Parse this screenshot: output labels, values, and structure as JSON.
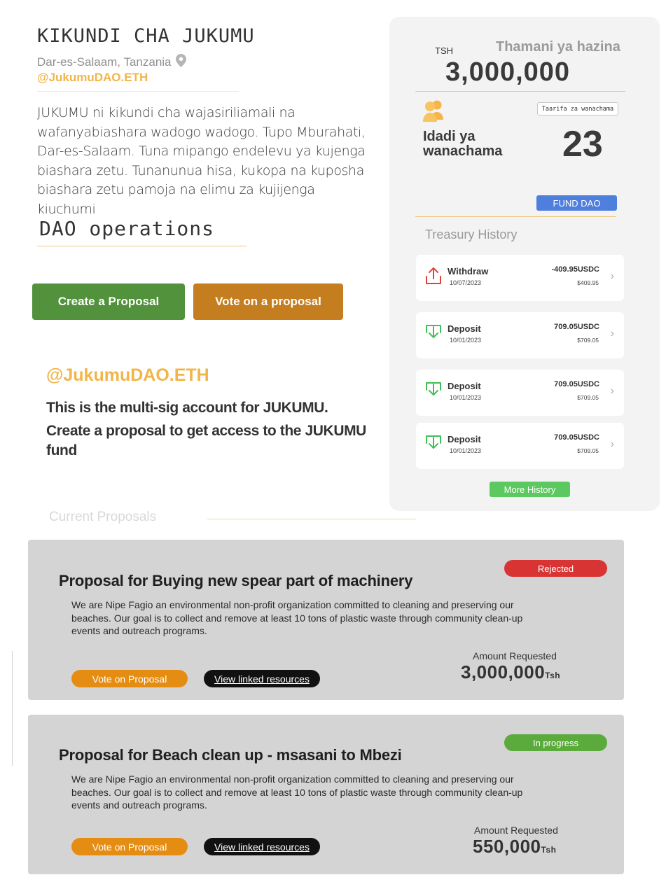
{
  "header": {
    "group_name": "KIKUNDI CHA JUKUMU",
    "location": "Dar-es-Salaam, Tanzania",
    "handle": "@JukumuDAO.ETH",
    "description": "JUKUMU ni kikundi cha wajasiriliamali na wafanyabiashara wadogo wadogo. Tupo Mburahati, Dar-es-Salaam. Tuna mipango endelevu ya kujenga biashara zetu. Tunanunua hisa, kukopa na kuposha biashara zetu pamoja na elimu za kujijenga kiuchumi"
  },
  "operations": {
    "title": "DAO operations",
    "create_label": "Create a Proposal",
    "vote_label": "Vote on a proposal"
  },
  "multisig": {
    "handle": "@JukumuDAO.ETH",
    "line1": "This is the multi-sig account for JUKUMU.",
    "line2": "Create a proposal to get access to the JUKUMU fund"
  },
  "current_proposals_label": "Current Proposals",
  "treasury": {
    "currency": "TSH",
    "label": "Thamani ya hazina",
    "value": "3,000,000",
    "members_button": "Taarifa za wanachama",
    "members_label": "Idadi ya wanachama",
    "members_count": "23",
    "fund_button": "FUND DAO",
    "history_title": "Treasury History",
    "transactions": [
      {
        "type": "Withdraw",
        "date": "10/07/2023",
        "amount": "-409.95USDC",
        "fiat": "$409.95",
        "direction": "out"
      },
      {
        "type": "Deposit",
        "date": "10/01/2023",
        "amount": "709.05USDC",
        "fiat": "$709.05",
        "direction": "in"
      },
      {
        "type": "Deposit",
        "date": "10/01/2023",
        "amount": "709.05USDC",
        "fiat": "$709.05",
        "direction": "in"
      },
      {
        "type": "Deposit",
        "date": "10/01/2023",
        "amount": "709.05USDC",
        "fiat": "$709.05",
        "direction": "in"
      }
    ],
    "more_button": "More History"
  },
  "proposals": [
    {
      "status": "Rejected",
      "status_color": "#d93434",
      "title": "Proposal for Buying new spear part of machinery",
      "description": "We are Nipe Fagio an environmental non-profit organization committed to cleaning and preserving our beaches. Our goal is to collect and remove at least 10 tons of plastic waste through community clean-up events and outreach programs.",
      "vote_label": "Vote on Proposal",
      "link_label": "View linked resources",
      "amount_label": "Amount Requested",
      "amount": "3,000,000",
      "unit": "Tsh"
    },
    {
      "status": "In progress",
      "status_color": "#5aaa3c",
      "title": "Proposal for Beach clean up - msasani to Mbezi",
      "description": "We are Nipe Fagio an environmental non-profit organization committed to cleaning and preserving our beaches. Our goal is to collect and remove at least 10 tons of plastic waste through community clean-up events and outreach programs.",
      "vote_label": "Vote on Proposal",
      "link_label": "View linked resources",
      "amount_label": "Amount Requested",
      "amount": "550,000",
      "unit": "Tsh"
    }
  ],
  "colors": {
    "accent_orange": "#f2b54a",
    "create_green": "#52923d",
    "vote_brown": "#c47d1f",
    "fund_blue": "#4f7fdc",
    "more_green": "#5cc860",
    "withdraw_red": "#e0413a",
    "deposit_green": "#3fbf55"
  }
}
